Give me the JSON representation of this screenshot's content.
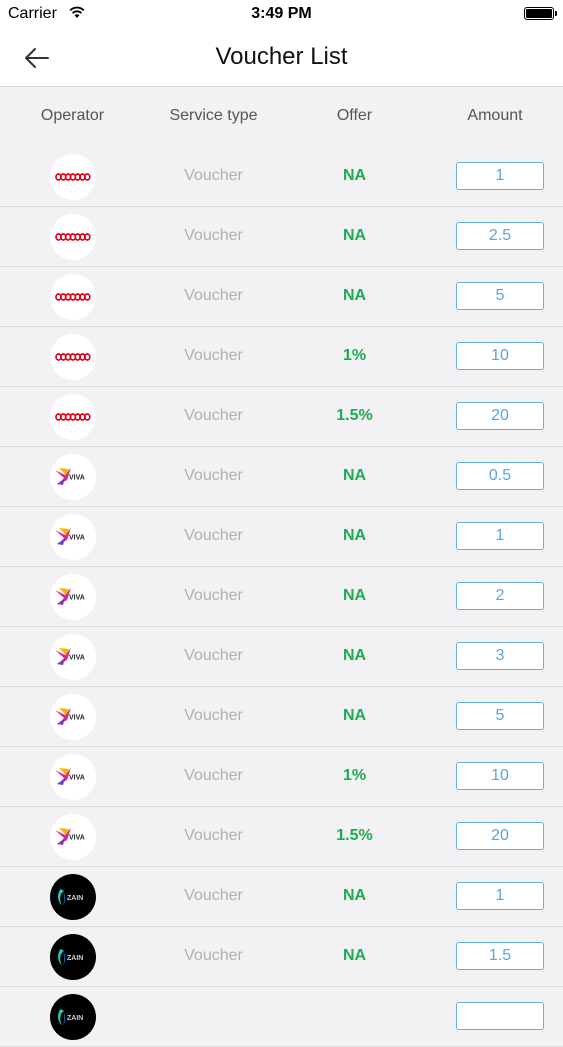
{
  "status_bar": {
    "carrier": "Carrier",
    "time": "3:49 PM"
  },
  "nav": {
    "title": "Voucher List"
  },
  "columns": {
    "operator": "Operator",
    "service_type": "Service type",
    "offer": "Offer",
    "amount": "Amount"
  },
  "colors": {
    "accent_blue": "#5aa5de",
    "offer_green": "#1dab4e",
    "ooredoo_red": "#e2001a"
  },
  "vouchers": [
    {
      "operator_icon": "ooredoo-logo-icon",
      "service": "Voucher",
      "offer": "NA",
      "amount": "1"
    },
    {
      "operator_icon": "ooredoo-logo-icon",
      "service": "Voucher",
      "offer": "NA",
      "amount": "2.5"
    },
    {
      "operator_icon": "ooredoo-logo-icon",
      "service": "Voucher",
      "offer": "NA",
      "amount": "5"
    },
    {
      "operator_icon": "ooredoo-logo-icon",
      "service": "Voucher",
      "offer": "1%",
      "amount": "10"
    },
    {
      "operator_icon": "ooredoo-logo-icon",
      "service": "Voucher",
      "offer": "1.5%",
      "amount": "20"
    },
    {
      "operator_icon": "viva-logo-icon",
      "service": "Voucher",
      "offer": "NA",
      "amount": "0.5"
    },
    {
      "operator_icon": "viva-logo-icon",
      "service": "Voucher",
      "offer": "NA",
      "amount": "1"
    },
    {
      "operator_icon": "viva-logo-icon",
      "service": "Voucher",
      "offer": "NA",
      "amount": "2"
    },
    {
      "operator_icon": "viva-logo-icon",
      "service": "Voucher",
      "offer": "NA",
      "amount": "3"
    },
    {
      "operator_icon": "viva-logo-icon",
      "service": "Voucher",
      "offer": "NA",
      "amount": "5"
    },
    {
      "operator_icon": "viva-logo-icon",
      "service": "Voucher",
      "offer": "1%",
      "amount": "10"
    },
    {
      "operator_icon": "viva-logo-icon",
      "service": "Voucher",
      "offer": "1.5%",
      "amount": "20"
    },
    {
      "operator_icon": "zain-logo-icon",
      "service": "Voucher",
      "offer": "NA",
      "amount": "1"
    },
    {
      "operator_icon": "zain-logo-icon",
      "service": "Voucher",
      "offer": "NA",
      "amount": "1.5"
    },
    {
      "operator_icon": "zain-logo-icon",
      "service": "",
      "offer": "",
      "amount": ""
    }
  ]
}
